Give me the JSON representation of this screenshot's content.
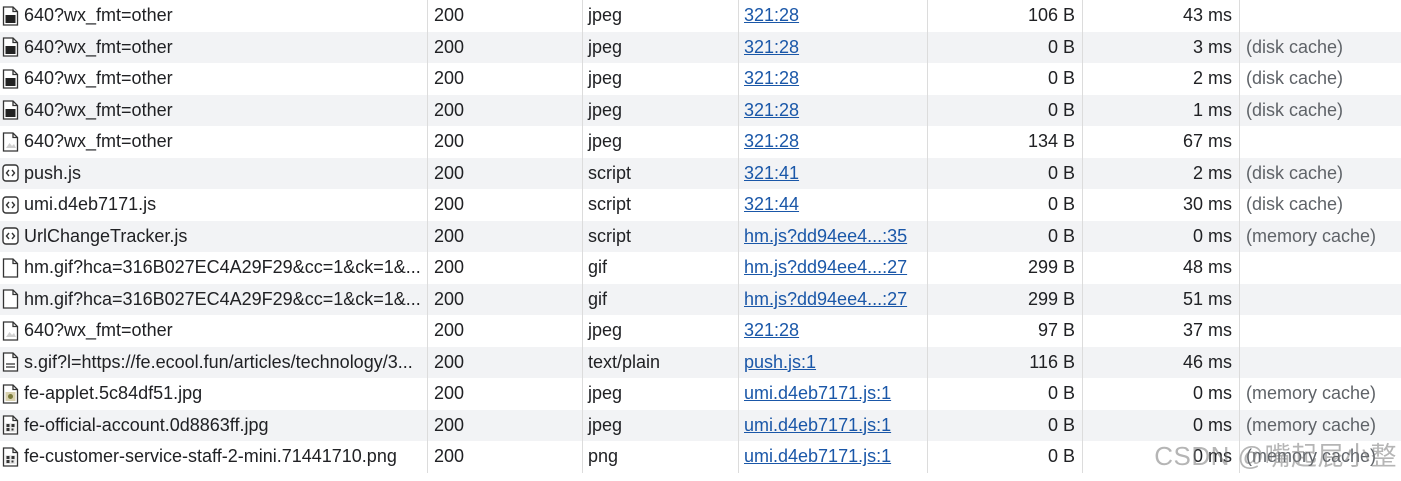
{
  "rows": [
    {
      "name": "640?wx_fmt=other",
      "status": "200",
      "type": "jpeg",
      "initiator": "321:28",
      "size": "106 B",
      "time": "43 ms",
      "note": "",
      "icon": "image-dark-icon"
    },
    {
      "name": "640?wx_fmt=other",
      "status": "200",
      "type": "jpeg",
      "initiator": "321:28",
      "size": "0 B",
      "time": "3 ms",
      "note": "(disk cache)",
      "icon": "image-dark-icon"
    },
    {
      "name": "640?wx_fmt=other",
      "status": "200",
      "type": "jpeg",
      "initiator": "321:28",
      "size": "0 B",
      "time": "2 ms",
      "note": "(disk cache)",
      "icon": "image-dark-icon"
    },
    {
      "name": "640?wx_fmt=other",
      "status": "200",
      "type": "jpeg",
      "initiator": "321:28",
      "size": "0 B",
      "time": "1 ms",
      "note": "(disk cache)",
      "icon": "image-dark-icon"
    },
    {
      "name": "640?wx_fmt=other",
      "status": "200",
      "type": "jpeg",
      "initiator": "321:28",
      "size": "134 B",
      "time": "67 ms",
      "note": "",
      "icon": "image-light-icon"
    },
    {
      "name": "push.js",
      "status": "200",
      "type": "script",
      "initiator": "321:41",
      "size": "0 B",
      "time": "2 ms",
      "note": "(disk cache)",
      "icon": "script-icon"
    },
    {
      "name": "umi.d4eb7171.js",
      "status": "200",
      "type": "script",
      "initiator": "321:44",
      "size": "0 B",
      "time": "30 ms",
      "note": "(disk cache)",
      "icon": "script-icon"
    },
    {
      "name": "UrlChangeTracker.js",
      "status": "200",
      "type": "script",
      "initiator": "hm.js?dd94ee4...:35",
      "size": "0 B",
      "time": "0 ms",
      "note": "(memory cache)",
      "icon": "script-icon"
    },
    {
      "name": "hm.gif?hca=316B027EC4A29F29&cc=1&ck=1&...",
      "status": "200",
      "type": "gif",
      "initiator": "hm.js?dd94ee4...:27",
      "size": "299 B",
      "time": "48 ms",
      "note": "",
      "icon": "document-icon"
    },
    {
      "name": "hm.gif?hca=316B027EC4A29F29&cc=1&ck=1&...",
      "status": "200",
      "type": "gif",
      "initiator": "hm.js?dd94ee4...:27",
      "size": "299 B",
      "time": "51 ms",
      "note": "",
      "icon": "document-icon"
    },
    {
      "name": "640?wx_fmt=other",
      "status": "200",
      "type": "jpeg",
      "initiator": "321:28",
      "size": "97 B",
      "time": "37 ms",
      "note": "",
      "icon": "image-light-icon"
    },
    {
      "name": "s.gif?l=https://fe.ecool.fun/articles/technology/3...",
      "status": "200",
      "type": "text/plain",
      "initiator": "push.js:1",
      "size": "116 B",
      "time": "46 ms",
      "note": "",
      "icon": "text-file-icon"
    },
    {
      "name": "fe-applet.5c84df51.jpg",
      "status": "200",
      "type": "jpeg",
      "initiator": "umi.d4eb7171.js:1",
      "size": "0 B",
      "time": "0 ms",
      "note": "(memory cache)",
      "icon": "image-thumb-icon"
    },
    {
      "name": "fe-official-account.0d8863ff.jpg",
      "status": "200",
      "type": "jpeg",
      "initiator": "umi.d4eb7171.js:1",
      "size": "0 B",
      "time": "0 ms",
      "note": "(memory cache)",
      "icon": "qr-thumb-icon"
    },
    {
      "name": "fe-customer-service-staff-2-mini.71441710.png",
      "status": "200",
      "type": "png",
      "initiator": "umi.d4eb7171.js:1",
      "size": "0 B",
      "time": "0 ms",
      "note": "(memory cache)",
      "icon": "qr-thumb-icon"
    }
  ],
  "watermark": "CSDN @嘴起屁小整",
  "colors": {
    "stripe": "#f2f3f5",
    "link": "#1a57a8",
    "divider": "#dcdcdc"
  }
}
